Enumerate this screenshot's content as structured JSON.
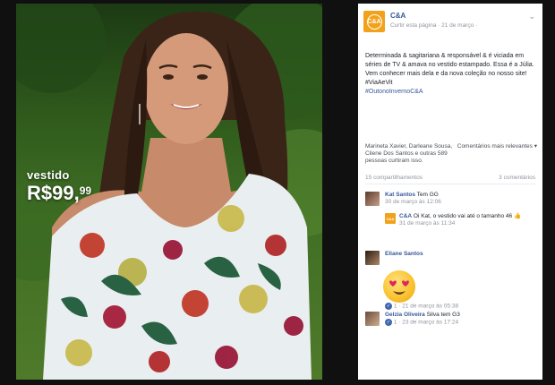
{
  "photo": {
    "price_label": "vestido",
    "price_main": "R$99,",
    "price_cents": "99"
  },
  "post": {
    "page_name": "C&A",
    "logo_text": "C&A",
    "meta": "Curtir esta página · 21 de março ·",
    "caption": "Determinada & sagitariana & responsável & é viciada em séries de TV & amava no vestido estampado. Essa é a Júlia. Vem conhecer mais dela e da nova coleção no nosso site! #ViaAeVit",
    "hashtag": "#OutonoInvernoC&A",
    "likers": "Marineta Xavier, Darleane Sousa, Cilene Dos Santos e outras 589 pessoas curtiram isso.",
    "relevance": "Comentários mais relevantes ▾",
    "shares": "15 compartilhamentos",
    "comments_count": "3 comentários"
  },
  "comments": [
    {
      "author": "Kat Santos",
      "text": "Tem GG",
      "meta": "30 de março às 12:06",
      "reply": {
        "author": "C&A",
        "logo_text": "C&A",
        "text": "Oi Kat, o vestido vai até o tamanho 46",
        "meta": "31 de março às 11:34"
      }
    },
    {
      "author": "Eliane Santos",
      "text": "",
      "meta": "1 · 21 de março às 05:38"
    },
    {
      "author": "Gelzia Oliveira",
      "text": "Silva tem G3",
      "meta": "1 · 23 de março às 17:24"
    }
  ],
  "colors": {
    "link": "#365899",
    "brand": "#f2a21a",
    "muted": "#90949c"
  }
}
